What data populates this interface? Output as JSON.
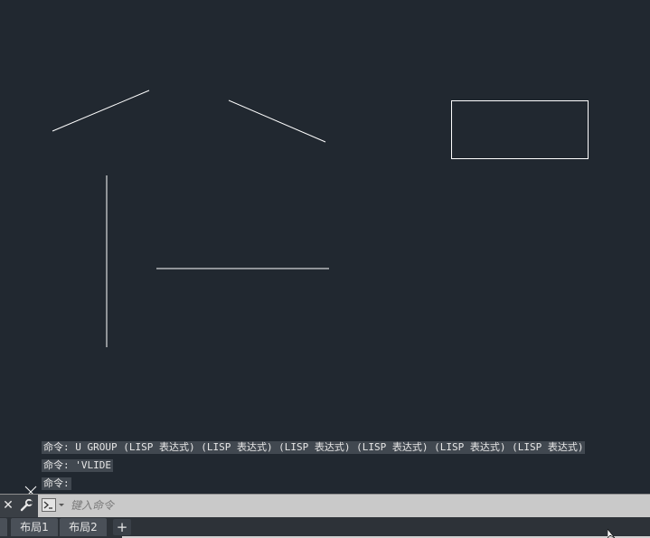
{
  "command_history": [
    "命令: U GROUP (LISP 表达式) (LISP 表达式) (LISP 表达式) (LISP 表达式) (LISP 表达式) (LISP 表达式)",
    "命令: 'VLIDE",
    "命令:"
  ],
  "command_line": {
    "placeholder": "键入命令",
    "value": ""
  },
  "layout_tabs": [
    {
      "label": "",
      "active": true
    },
    {
      "label": "布局1"
    },
    {
      "label": "布局2"
    }
  ],
  "add_tab_label": "+",
  "icons": {
    "close": "close-icon",
    "customize": "wrench-icon",
    "prompt": "command-prompt-icon",
    "crosshair": "crosshair-cursor-icon",
    "pointer": "arrow-cursor-icon"
  },
  "colors": {
    "canvas_bg": "#212830",
    "geometry": "#ffffff",
    "command_bar": "#c9c9c9",
    "tab_bg": "#4a5058"
  }
}
